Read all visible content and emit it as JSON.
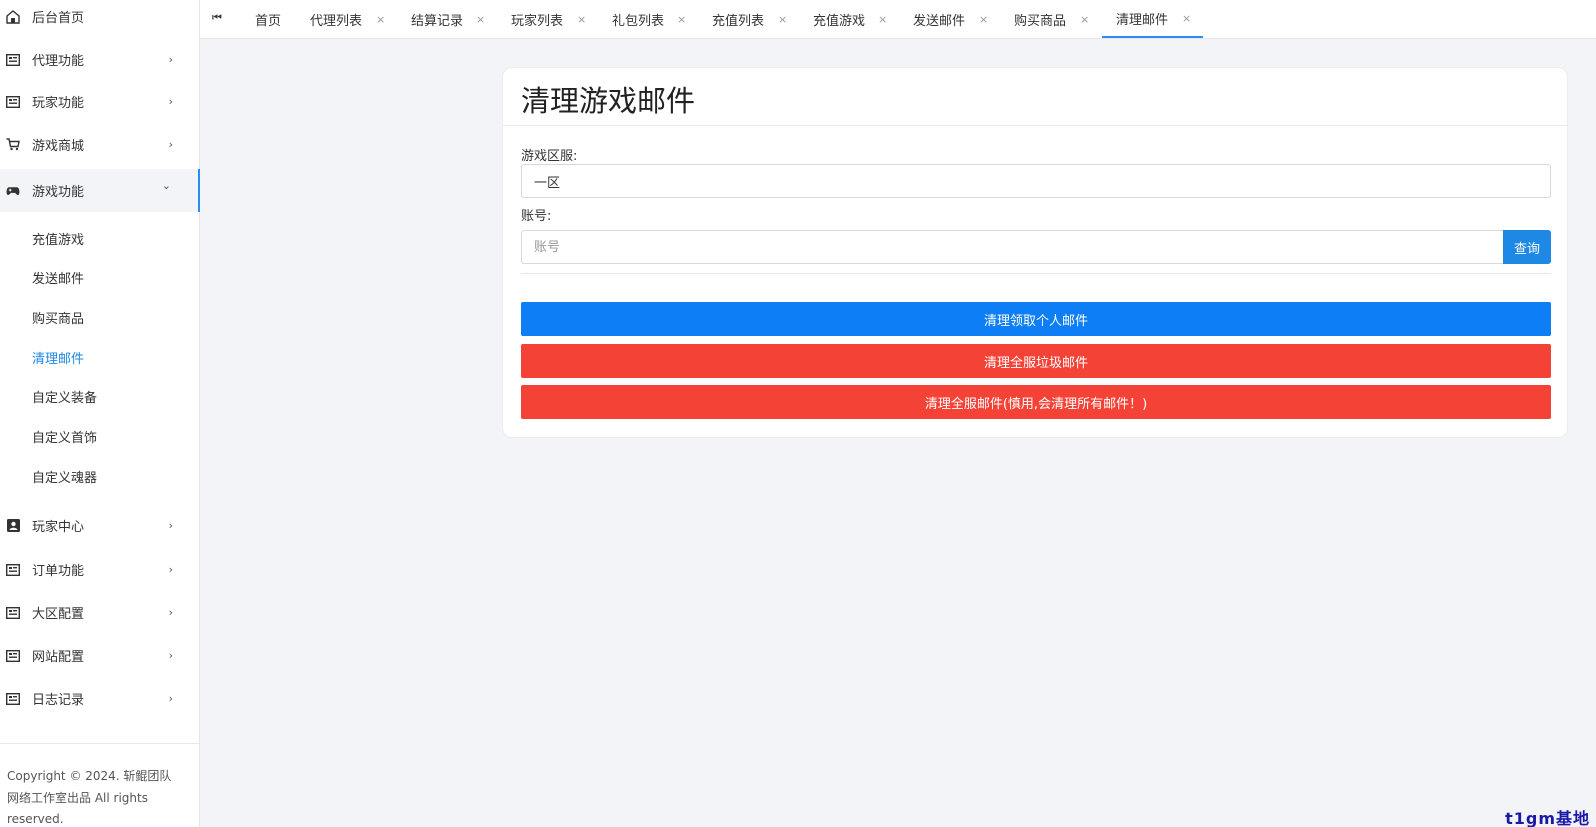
{
  "sidebar": {
    "menu": [
      {
        "label": "后台首页",
        "icon": "home-icon",
        "chevron": ""
      },
      {
        "label": "代理功能",
        "icon": "list-icon",
        "chevron": "›"
      },
      {
        "label": "玩家功能",
        "icon": "list-icon",
        "chevron": "›"
      },
      {
        "label": "游戏商城",
        "icon": "cart-icon",
        "chevron": "›"
      },
      {
        "label": "游戏功能",
        "icon": "gamepad-icon",
        "chevron": "⌄"
      }
    ],
    "submenu": [
      {
        "label": "充值游戏"
      },
      {
        "label": "发送邮件"
      },
      {
        "label": "购买商品"
      },
      {
        "label": "清理邮件"
      },
      {
        "label": "自定义装备"
      },
      {
        "label": "自定义首饰"
      },
      {
        "label": "自定义魂器"
      }
    ],
    "menu_bottom": [
      {
        "label": "玩家中心",
        "icon": "user-card-icon",
        "chevron": "›"
      },
      {
        "label": "订单功能",
        "icon": "list-icon",
        "chevron": "›"
      },
      {
        "label": "大区配置",
        "icon": "list-icon",
        "chevron": "›"
      },
      {
        "label": "网站配置",
        "icon": "list-icon",
        "chevron": "›"
      },
      {
        "label": "日志记录",
        "icon": "list-icon",
        "chevron": "›"
      }
    ],
    "copyright": "Copyright © 2024. 斩鲲团队网络工作室出品 All rights reserved."
  },
  "tabs": {
    "first_icon": "⏮",
    "items": [
      {
        "label": "首页",
        "close": ""
      },
      {
        "label": "代理列表",
        "close": "×"
      },
      {
        "label": "结算记录",
        "close": "×"
      },
      {
        "label": "玩家列表",
        "close": "×"
      },
      {
        "label": "礼包列表",
        "close": "×"
      },
      {
        "label": "充值列表",
        "close": "×"
      },
      {
        "label": "充值游戏",
        "close": "×"
      },
      {
        "label": "发送邮件",
        "close": "×"
      },
      {
        "label": "购买商品",
        "close": "×"
      },
      {
        "label": "清理邮件",
        "close": "×"
      }
    ]
  },
  "card": {
    "title": "清理游戏邮件",
    "server_label": "游戏区服:",
    "server_value": "一区",
    "account_label": "账号:",
    "account_placeholder": "账号",
    "query_label": "查询",
    "btn_personal": "清理领取个人邮件",
    "btn_junk": "清理全服垃圾邮件",
    "btn_all": "清理全服邮件(慎用,会清理所有邮件！)"
  },
  "watermark": "t1gm基地",
  "colors": {
    "accent": "#1e88e5",
    "danger": "#f44336",
    "primary_btn": "#0d7ef5"
  }
}
